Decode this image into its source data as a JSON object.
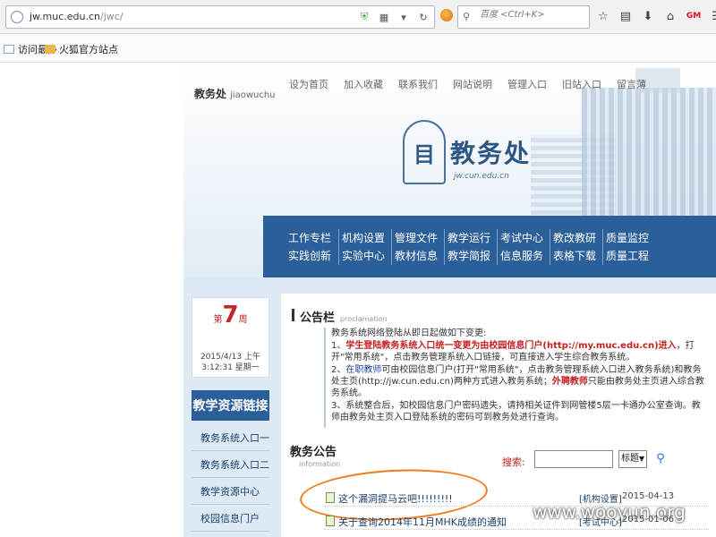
{
  "browser": {
    "url_main": "jw.muc.edu.cn",
    "url_path": "/jwc/",
    "search_placeholder": "百度 <Ctrl+K>",
    "bookmarks": [
      {
        "label": "访问最多"
      },
      {
        "label": "火狐官方站点"
      }
    ],
    "gm_label": "GM"
  },
  "site": {
    "title": "教务处",
    "pinyin": "jiaowuchu",
    "top_nav": [
      "设为首页",
      "加入收藏",
      "联系我们",
      "网站说明",
      "管理入口",
      "旧站入口",
      "留言薄"
    ],
    "logo_text": "教务处",
    "logo_domain": "jw.cun.edu.cn",
    "main_nav": [
      [
        "工作专栏",
        "实践创新"
      ],
      [
        "机构设置",
        "实验中心"
      ],
      [
        "管理文件",
        "教材信息"
      ],
      [
        "教学运行",
        "教学简报"
      ],
      [
        "考试中心",
        "信息服务"
      ],
      [
        "教改教研",
        "表格下载"
      ],
      [
        "质量监控",
        "质量工程"
      ]
    ]
  },
  "sidebar": {
    "week_prefix": "第",
    "week_num": "7",
    "week_suffix": "周",
    "date_line1": "2015/4/13 上午",
    "date_line2": "3:12:31 星期一",
    "resource_title": "教学资源链接",
    "resource_items": [
      "教务系统入口一",
      "教务系统入口二",
      "教学资源中心",
      "校园信息门户"
    ]
  },
  "bulletin": {
    "title": "公告栏",
    "title_en": "proclamation",
    "intro": "教务系统网络登陆从即日起做如下变更:",
    "p1_a": "1、",
    "p1_red": "学生登陆教务系统入口统一变更为由校园信息门户(http://my.muc.edu.cn)进入",
    "p1_b": "，打开\"常用系统\"，点击教务管理系统入口链接，可直接进入学生综合教务系统。",
    "p2_a": "2、",
    "p2_blue": "在职教师",
    "p2_b": "可由校园信息门户(打开\"常用系统\"，点击教务管理系统入口进入教务系统)和教务处主页(http://jw.cun.edu.cn)两种方式进入教务系统；",
    "p2_red": "外聘教师",
    "p2_c": "只能由教务处主页进入综合教务系统。",
    "p3": "3、系统整合后，如校园信息门户密码遗失，请持相关证件到网管楼5层一卡通办公室查询。教师由教务处主页入口登陆系统的密码可到教务处进行查询。"
  },
  "news": {
    "title": "教务公告",
    "title_en": "information",
    "search_label": "搜索:",
    "search_value": "",
    "select_value": "标题",
    "rows": [
      {
        "title": "这个漏洞提马云吧!!!!!!!!!",
        "category": "[机构设置]",
        "date": "2015-04-13"
      },
      {
        "title": "关于查询2014年11月MHK成绩的通知",
        "category": "[考试中心]",
        "date": "2015-01-06"
      }
    ]
  },
  "watermark": "www.wooyun.org",
  "colors": {
    "nav_blue": "#2b5f99",
    "highlight_red": "#c21f1f",
    "annotation_orange": "#f07a1f"
  }
}
